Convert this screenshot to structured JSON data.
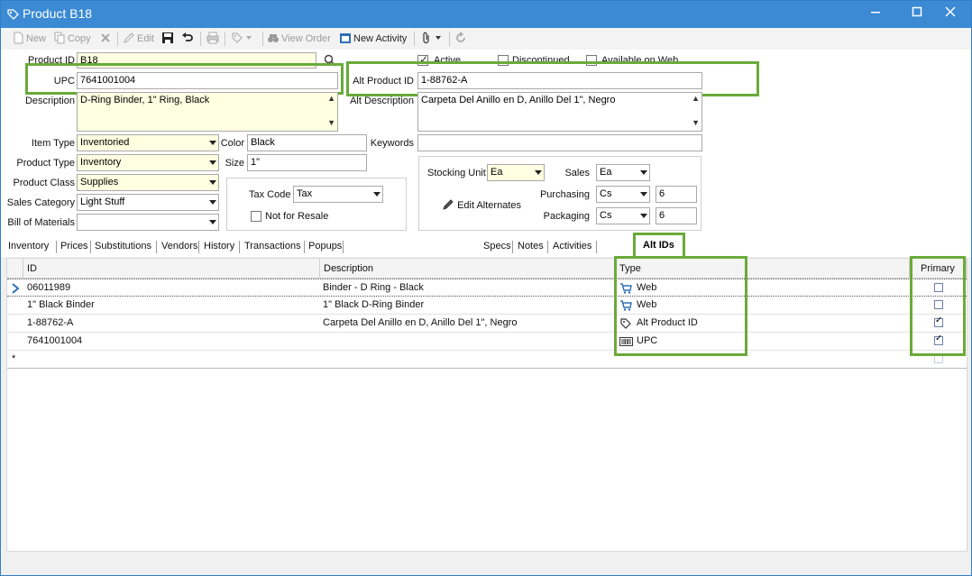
{
  "window": {
    "title": "Product B18"
  },
  "toolbar": {
    "new_label": "New",
    "copy_label": "Copy",
    "edit_label": "Edit",
    "view_order_label": "View Order",
    "new_activity_label": "New Activity"
  },
  "form": {
    "product_id": {
      "label": "Product ID",
      "value": "B18"
    },
    "upc": {
      "label": "UPC",
      "value": "7641001004"
    },
    "description": {
      "label": "Description",
      "value": "D-Ring Binder, 1\" Ring, Black"
    },
    "active": {
      "label": "Active",
      "checked": true
    },
    "discontinued": {
      "label": "Discontinued",
      "checked": false
    },
    "available_on_web": {
      "label": "Available on Web",
      "checked": false
    },
    "alt_product_id": {
      "label": "Alt Product ID",
      "value": "1-88762-A"
    },
    "alt_description": {
      "label": "Alt Description",
      "value": "Carpeta Del Anillo en D, Anillo Del 1\", Negro"
    },
    "item_type": {
      "label": "Item Type",
      "value": "Inventoried"
    },
    "product_type": {
      "label": "Product Type",
      "value": "Inventory"
    },
    "product_class": {
      "label": "Product Class",
      "value": "Supplies"
    },
    "sales_category": {
      "label": "Sales Category",
      "value": "Light Stuff"
    },
    "bill_of_materials": {
      "label": "Bill of Materials",
      "value": ""
    },
    "color": {
      "label": "Color",
      "value": "Black"
    },
    "size": {
      "label": "Size",
      "value": "1\""
    },
    "keywords": {
      "label": "Keywords",
      "value": ""
    },
    "tax_code": {
      "label": "Tax Code",
      "value": "Tax"
    },
    "not_for_resale": {
      "label": "Not for Resale",
      "checked": false
    },
    "stocking_unit": {
      "label": "Stocking Unit",
      "value": "Ea"
    },
    "sales": {
      "label": "Sales",
      "value": "Ea"
    },
    "purchasing": {
      "label": "Purchasing",
      "unit": "Cs",
      "qty": "6"
    },
    "packaging": {
      "label": "Packaging",
      "unit": "Cs",
      "qty": "6"
    },
    "edit_alternates_label": "Edit Alternates"
  },
  "tabs_left": [
    "Inventory",
    "Prices",
    "Substitutions",
    "Vendors",
    "History",
    "Transactions",
    "Popups"
  ],
  "tabs_right": [
    "Specs",
    "Notes",
    "Activities",
    "Alt IDs"
  ],
  "active_tab": "Alt IDs",
  "grid": {
    "columns": {
      "id": "ID",
      "description": "Description",
      "type": "Type",
      "primary": "Primary"
    },
    "rows": [
      {
        "id": "06011989",
        "description": "Binder - D Ring - Black",
        "type": "Web",
        "type_icon": "cart-icon",
        "primary": false,
        "current": true
      },
      {
        "id": "1\" Black Binder",
        "description": "1\" Black D-Ring Binder",
        "type": "Web",
        "type_icon": "cart-icon",
        "primary": false
      },
      {
        "id": "1-88762-A",
        "description": "Carpeta Del Anillo en D, Anillo Del 1\", Negro",
        "type": "Alt Product ID",
        "type_icon": "tag-icon",
        "primary": true
      },
      {
        "id": "7641001004",
        "description": "",
        "type": "UPC",
        "type_icon": "barcode-icon",
        "primary": true
      }
    ],
    "new_row_marker": "*"
  },
  "colors": {
    "titlebar": "#3b8ad3",
    "highlight": "#6aaa3a",
    "required_field": "#ffffe1"
  }
}
